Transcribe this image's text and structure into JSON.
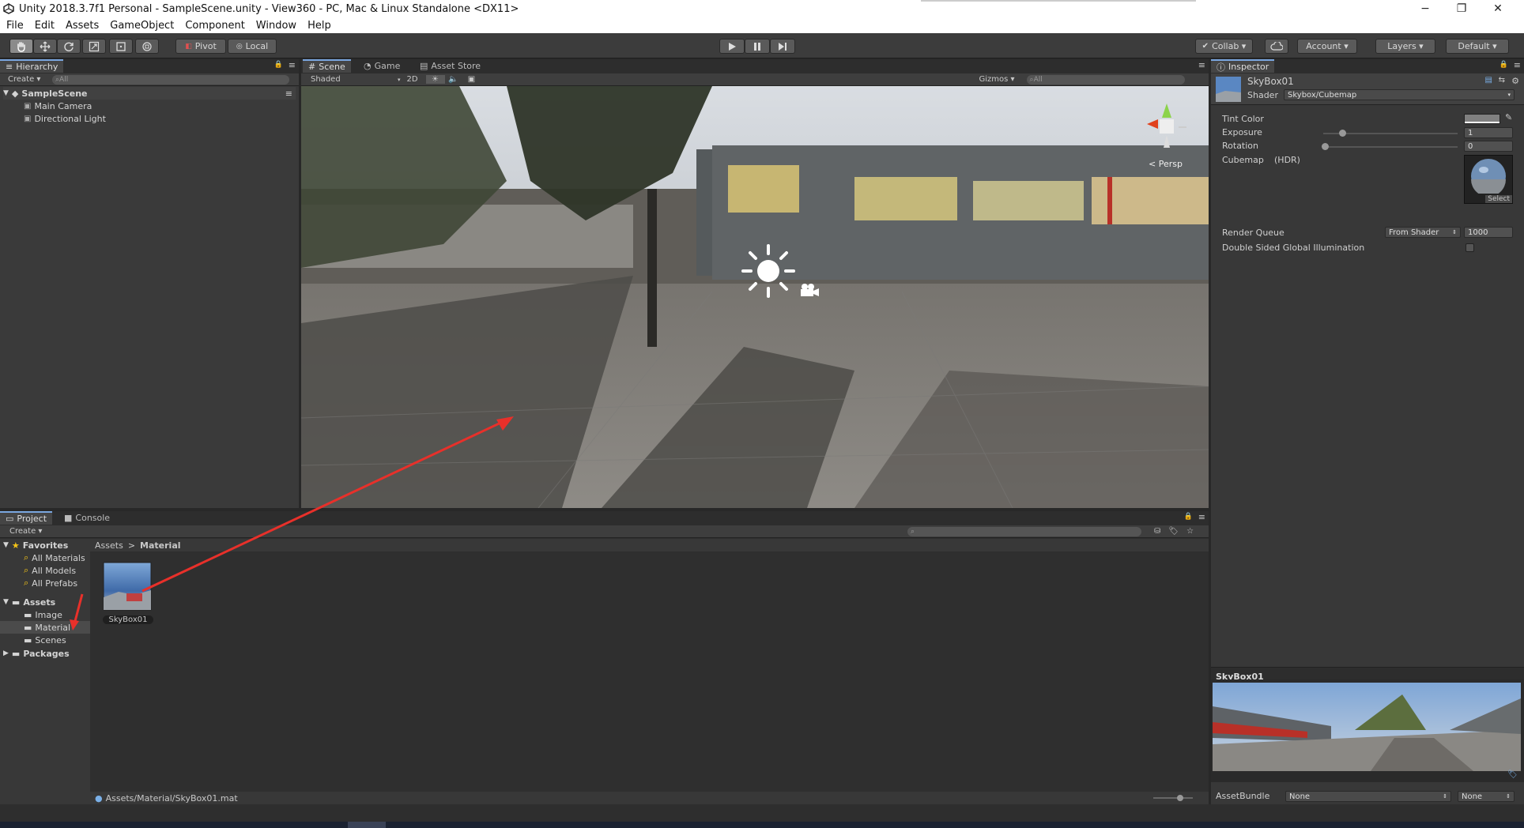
{
  "window": {
    "title": "Unity 2018.3.7f1 Personal - SampleScene.unity - View360 - PC, Mac & Linux Standalone <DX11>",
    "minimize": "−",
    "restore": "❐",
    "close": "✕"
  },
  "menu": [
    "File",
    "Edit",
    "Assets",
    "GameObject",
    "Component",
    "Window",
    "Help"
  ],
  "toolbar": {
    "pivot": "Pivot",
    "local": "Local",
    "collab": "Collab ▾",
    "account": "Account ▾",
    "layers": "Layers ▾",
    "layout": "Default ▾"
  },
  "hierarchy": {
    "tab": "Hierarchy",
    "create": "Create ▾",
    "search_placeholder": "All",
    "scene": "SampleScene",
    "items": [
      "Main Camera",
      "Directional Light"
    ]
  },
  "scene": {
    "tabs": [
      "Scene",
      "Game",
      "Asset Store"
    ],
    "shaded": "Shaded",
    "mode_2d": "2D",
    "gizmos": "Gizmos ▾",
    "search_placeholder": "All",
    "persp": "Persp"
  },
  "project": {
    "tabs": [
      "Project",
      "Console"
    ],
    "create": "Create ▾",
    "favorites_label": "Favorites",
    "favorites": [
      "All Materials",
      "All Models",
      "All Prefabs"
    ],
    "assets_label": "Assets",
    "assets": [
      "Image",
      "Material",
      "Scenes"
    ],
    "packages_label": "Packages",
    "breadcrumb": [
      "Assets",
      "Material"
    ],
    "asset_name": "SkyBox01",
    "path": "Assets/Material/SkyBox01.mat"
  },
  "inspector": {
    "tab": "Inspector",
    "name": "SkyBox01",
    "shader_label": "Shader",
    "shader_value": "Skybox/Cubemap",
    "tint_label": "Tint Color",
    "exposure_label": "Exposure",
    "exposure_value": "1",
    "rotation_label": "Rotation",
    "rotation_value": "0",
    "cubemap_label": "Cubemap",
    "cubemap_hint": "(HDR)",
    "select_label": "Select",
    "render_queue_label": "Render Queue",
    "render_queue_mode": "From Shader",
    "render_queue_value": "1000",
    "dsgi_label": "Double Sided Global Illumination",
    "preview_title": "SkyBox01",
    "assetbundle_label": "AssetBundle",
    "assetbundle_value": "None",
    "assetbundle_variant": "None"
  }
}
